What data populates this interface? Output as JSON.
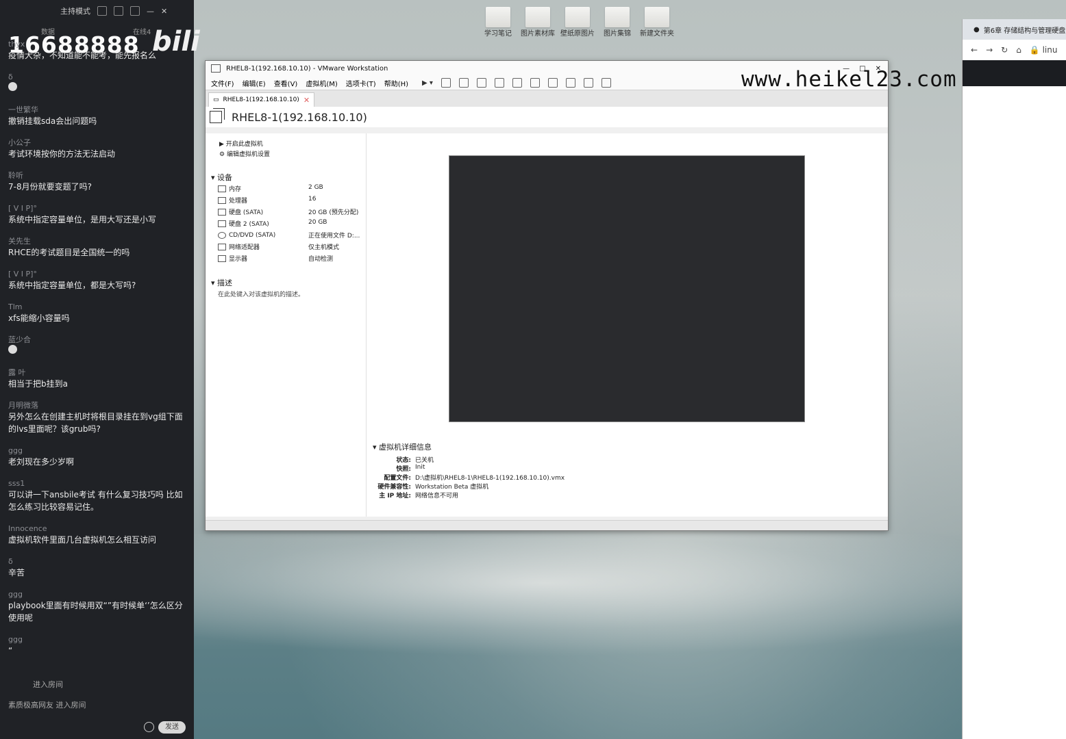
{
  "chat": {
    "top_title": "主持模式",
    "big_number": "16688888",
    "bili_logo": "bilibili",
    "header_left": "数据",
    "header_right": "在线4",
    "messages": [
      {
        "user": "thyx",
        "text": "疫情大杂，不知道能不能考，能先报名么"
      },
      {
        "user": "δ",
        "text": ""
      },
      {
        "user": "一世繁华",
        "text": "撤销挂载sda会出问题吗"
      },
      {
        "user": "小公子",
        "text": "考试环境按你的方法无法启动"
      },
      {
        "user": "聆听",
        "text": "7-8月份就要变题了吗?"
      },
      {
        "user": "[ V I P]°",
        "text": "系统中指定容量单位，是用大写还是小写"
      },
      {
        "user": "关先生",
        "text": "RHCE的考试题目是全国统一的吗"
      },
      {
        "user": "[ V I P]°",
        "text": "系统中指定容量单位，都是大写吗?"
      },
      {
        "user": "Tlm",
        "text": "xfs能缩小容量吗"
      },
      {
        "user": "蓝少合",
        "text": ""
      },
      {
        "user": "露 叶",
        "text": "相当于把b挂到a"
      },
      {
        "user": "月明微落",
        "text": "另外怎么在创建主机时将根目录挂在到vg组下面的lvs里面呢？该grub吗?"
      },
      {
        "user": "ggg",
        "text": "老刘现在多少岁啊"
      },
      {
        "user": "sss1",
        "text": "可以讲一下ansbile考试 有什么复习技巧吗 比如怎么练习比较容易记住。"
      },
      {
        "user": "Innocence",
        "text": "虚拟机软件里面几台虚拟机怎么相互访问"
      },
      {
        "user": "δ",
        "text": "辛苦"
      },
      {
        "user": "ggg",
        "text": "playbook里面有时候用双“”有时候单‘’怎么区分使用呢"
      },
      {
        "user": "ggg",
        "text": "“"
      }
    ],
    "enter_room_1": "进入房间",
    "enter_room_2": "素质极高网友 进入房间",
    "send_label": "发送"
  },
  "desktop_icons": [
    "学习笔记",
    "图片素材库",
    "壁纸原图片",
    "图片集锦",
    "新建文件夹"
  ],
  "vmware": {
    "title": "RHEL8-1(192.168.10.10) - VMware Workstation",
    "menus": [
      "文件(F)",
      "编辑(E)",
      "查看(V)",
      "虚拟机(M)",
      "选项卡(T)",
      "帮助(H)"
    ],
    "tab_label": "RHEL8-1(192.168.10.10)",
    "vm_name": "RHEL8-1(192.168.10.10)",
    "actions": [
      "开启此虚拟机",
      "编辑虚拟机设置"
    ],
    "devices_title": "设备",
    "devices": [
      {
        "name": "内存",
        "value": "2 GB"
      },
      {
        "name": "处理器",
        "value": "16"
      },
      {
        "name": "硬盘 (SATA)",
        "value": "20 GB (预先分配)"
      },
      {
        "name": "硬盘 2 (SATA)",
        "value": "20 GB"
      },
      {
        "name": "CD/DVD (SATA)",
        "value": "正在使用文件 D:..."
      },
      {
        "name": "网络适配器",
        "value": "仅主机模式"
      },
      {
        "name": "显示器",
        "value": "自动检测"
      }
    ],
    "desc_title": "描述",
    "desc_placeholder": "在此处键入对该虚拟机的描述。",
    "details_title": "虚拟机详细信息",
    "details": [
      {
        "k": "状态:",
        "v": "已关机"
      },
      {
        "k": "快照:",
        "v": "Init"
      },
      {
        "k": "配置文件:",
        "v": "D:\\虚拟机\\RHEL8-1\\RHEL8-1(192.168.10.10).vmx"
      },
      {
        "k": "硬件兼容性:",
        "v": "Workstation Beta 虚拟机"
      },
      {
        "k": "主 IP 地址:",
        "v": "网络信息不可用"
      }
    ]
  },
  "watermark": "www.heikel23.com",
  "browser": {
    "tab_label": "第6章 存储结构与管理硬盘",
    "url": "linu"
  }
}
